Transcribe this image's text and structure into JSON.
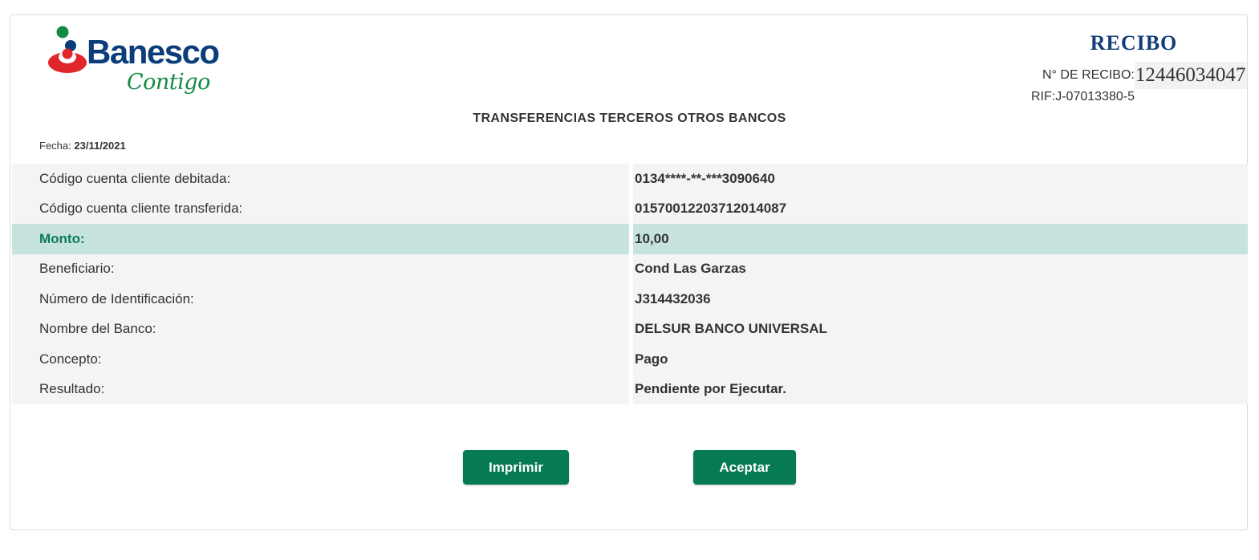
{
  "logo": {
    "brand": "Banesco",
    "tagline": "Contigo"
  },
  "header": {
    "title": "RECIBO",
    "receipt_label": "N° DE RECIBO:",
    "receipt_number": "12446034047",
    "rif": "RIF:J-07013380-5"
  },
  "page_title": "TRANSFERENCIAS TERCEROS OTROS BANCOS",
  "fecha": {
    "label": "Fecha:",
    "value": "23/11/2021"
  },
  "details": [
    {
      "label": "Código cuenta cliente debitada:",
      "value": "0134****-**-***3090640"
    },
    {
      "label": "Código cuenta cliente transferida:",
      "value": "01570012203712014087"
    },
    {
      "label": "Monto:",
      "value": "10,00"
    },
    {
      "label": "Beneficiario:",
      "value": "Cond Las Garzas"
    },
    {
      "label": "Número de Identificación:",
      "value": "J314432036"
    },
    {
      "label": "Nombre del Banco:",
      "value": "DELSUR BANCO UNIVERSAL"
    },
    {
      "label": "Concepto:",
      "value": "Pago"
    },
    {
      "label": "Resultado:",
      "value": "Pendiente por Ejecutar."
    }
  ],
  "buttons": {
    "print": "Imprimir",
    "accept": "Aceptar"
  },
  "colors": {
    "brand_blue": "#0b3d7a",
    "brand_green": "#158a45",
    "brand_red": "#e0262b",
    "button_green": "#067a52",
    "highlight_row": "#c6e3dd",
    "highlight_text": "#0d7a5f"
  },
  "icons": {
    "logo_mark": "banesco-logo-icon"
  }
}
